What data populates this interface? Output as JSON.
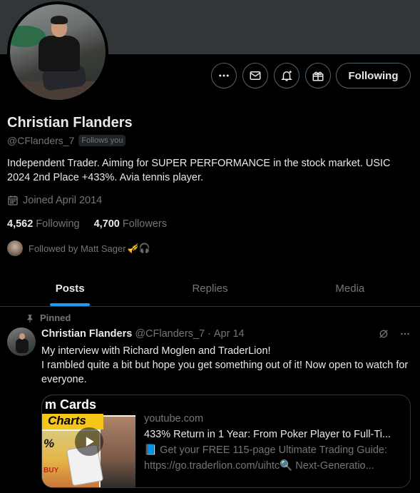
{
  "profile": {
    "name": "Christian Flanders",
    "handle": "@CFlanders_7",
    "follows_you": "Follows you",
    "bio": "Independent Trader. Aiming for SUPER PERFORMANCE in the stock market. USIC 2024 2nd Place +433%. Avia tennis player.",
    "joined": "Joined April 2014",
    "following_count": "4,562",
    "following_label": "Following",
    "followers_count": "4,700",
    "followers_label": "Followers",
    "followed_by": "Followed by Matt Sager",
    "followed_by_emoji": "🎺🎧"
  },
  "actions": {
    "follow_button": "Following",
    "icons": [
      "more-icon",
      "message-icon",
      "notification-bell-icon",
      "subscribe-gift-icon"
    ]
  },
  "tabs": [
    {
      "label": "Posts",
      "active": true
    },
    {
      "label": "Replies",
      "active": false
    },
    {
      "label": "Media",
      "active": false
    }
  ],
  "post": {
    "pinned_label": "Pinned",
    "author": "Christian Flanders",
    "handle": "@CFlanders_7",
    "separator": "·",
    "date": "Apr 14",
    "text_line1": "My interview with Richard Moglen and TraderLion!",
    "text_line2": "I rambled quite a bit but hope you get something out of it! Now open to watch for everyone.",
    "card": {
      "domain": "youtube.com",
      "title": "433% Return in 1 Year: From Poker Player to Full-Ti...",
      "desc_line1": "📘 Get your FREE 115-page Ultimate Trading Guide:",
      "desc_line2": "https://go.traderlion.com/uihtc🔍 Next-Generatio...",
      "thumb_text_top": "m Cards",
      "thumb_text_yellow": "Charts",
      "thumb_text_left": "%",
      "thumb_text_buy": "BUY"
    }
  },
  "colors": {
    "background": "#000000",
    "banner": "#333639",
    "accent": "#1d9bf0",
    "muted": "#71767b",
    "text": "#e7e9ea",
    "border": "#2f3336"
  }
}
